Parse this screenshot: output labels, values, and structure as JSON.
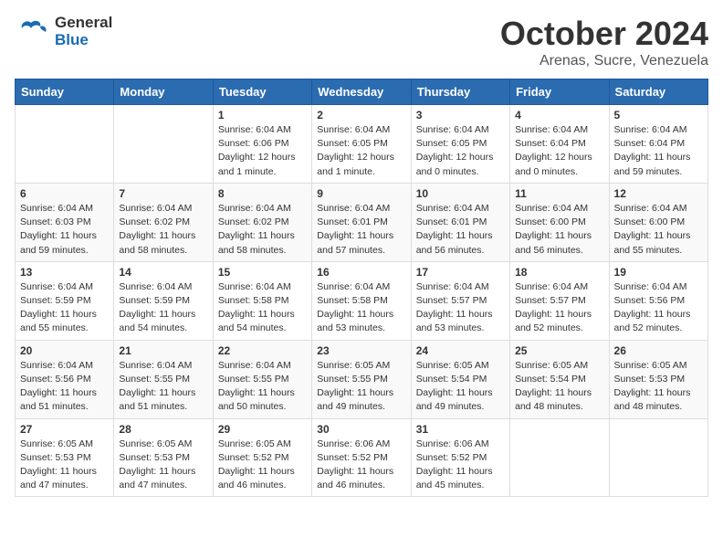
{
  "header": {
    "logo_general": "General",
    "logo_blue": "Blue",
    "month": "October 2024",
    "location": "Arenas, Sucre, Venezuela"
  },
  "weekdays": [
    "Sunday",
    "Monday",
    "Tuesday",
    "Wednesday",
    "Thursday",
    "Friday",
    "Saturday"
  ],
  "weeks": [
    [
      {
        "day": "",
        "info": ""
      },
      {
        "day": "",
        "info": ""
      },
      {
        "day": "1",
        "info": "Sunrise: 6:04 AM\nSunset: 6:06 PM\nDaylight: 12 hours\nand 1 minute."
      },
      {
        "day": "2",
        "info": "Sunrise: 6:04 AM\nSunset: 6:05 PM\nDaylight: 12 hours\nand 1 minute."
      },
      {
        "day": "3",
        "info": "Sunrise: 6:04 AM\nSunset: 6:05 PM\nDaylight: 12 hours\nand 0 minutes."
      },
      {
        "day": "4",
        "info": "Sunrise: 6:04 AM\nSunset: 6:04 PM\nDaylight: 12 hours\nand 0 minutes."
      },
      {
        "day": "5",
        "info": "Sunrise: 6:04 AM\nSunset: 6:04 PM\nDaylight: 11 hours\nand 59 minutes."
      }
    ],
    [
      {
        "day": "6",
        "info": "Sunrise: 6:04 AM\nSunset: 6:03 PM\nDaylight: 11 hours\nand 59 minutes."
      },
      {
        "day": "7",
        "info": "Sunrise: 6:04 AM\nSunset: 6:02 PM\nDaylight: 11 hours\nand 58 minutes."
      },
      {
        "day": "8",
        "info": "Sunrise: 6:04 AM\nSunset: 6:02 PM\nDaylight: 11 hours\nand 58 minutes."
      },
      {
        "day": "9",
        "info": "Sunrise: 6:04 AM\nSunset: 6:01 PM\nDaylight: 11 hours\nand 57 minutes."
      },
      {
        "day": "10",
        "info": "Sunrise: 6:04 AM\nSunset: 6:01 PM\nDaylight: 11 hours\nand 56 minutes."
      },
      {
        "day": "11",
        "info": "Sunrise: 6:04 AM\nSunset: 6:00 PM\nDaylight: 11 hours\nand 56 minutes."
      },
      {
        "day": "12",
        "info": "Sunrise: 6:04 AM\nSunset: 6:00 PM\nDaylight: 11 hours\nand 55 minutes."
      }
    ],
    [
      {
        "day": "13",
        "info": "Sunrise: 6:04 AM\nSunset: 5:59 PM\nDaylight: 11 hours\nand 55 minutes."
      },
      {
        "day": "14",
        "info": "Sunrise: 6:04 AM\nSunset: 5:59 PM\nDaylight: 11 hours\nand 54 minutes."
      },
      {
        "day": "15",
        "info": "Sunrise: 6:04 AM\nSunset: 5:58 PM\nDaylight: 11 hours\nand 54 minutes."
      },
      {
        "day": "16",
        "info": "Sunrise: 6:04 AM\nSunset: 5:58 PM\nDaylight: 11 hours\nand 53 minutes."
      },
      {
        "day": "17",
        "info": "Sunrise: 6:04 AM\nSunset: 5:57 PM\nDaylight: 11 hours\nand 53 minutes."
      },
      {
        "day": "18",
        "info": "Sunrise: 6:04 AM\nSunset: 5:57 PM\nDaylight: 11 hours\nand 52 minutes."
      },
      {
        "day": "19",
        "info": "Sunrise: 6:04 AM\nSunset: 5:56 PM\nDaylight: 11 hours\nand 52 minutes."
      }
    ],
    [
      {
        "day": "20",
        "info": "Sunrise: 6:04 AM\nSunset: 5:56 PM\nDaylight: 11 hours\nand 51 minutes."
      },
      {
        "day": "21",
        "info": "Sunrise: 6:04 AM\nSunset: 5:55 PM\nDaylight: 11 hours\nand 51 minutes."
      },
      {
        "day": "22",
        "info": "Sunrise: 6:04 AM\nSunset: 5:55 PM\nDaylight: 11 hours\nand 50 minutes."
      },
      {
        "day": "23",
        "info": "Sunrise: 6:05 AM\nSunset: 5:55 PM\nDaylight: 11 hours\nand 49 minutes."
      },
      {
        "day": "24",
        "info": "Sunrise: 6:05 AM\nSunset: 5:54 PM\nDaylight: 11 hours\nand 49 minutes."
      },
      {
        "day": "25",
        "info": "Sunrise: 6:05 AM\nSunset: 5:54 PM\nDaylight: 11 hours\nand 48 minutes."
      },
      {
        "day": "26",
        "info": "Sunrise: 6:05 AM\nSunset: 5:53 PM\nDaylight: 11 hours\nand 48 minutes."
      }
    ],
    [
      {
        "day": "27",
        "info": "Sunrise: 6:05 AM\nSunset: 5:53 PM\nDaylight: 11 hours\nand 47 minutes."
      },
      {
        "day": "28",
        "info": "Sunrise: 6:05 AM\nSunset: 5:53 PM\nDaylight: 11 hours\nand 47 minutes."
      },
      {
        "day": "29",
        "info": "Sunrise: 6:05 AM\nSunset: 5:52 PM\nDaylight: 11 hours\nand 46 minutes."
      },
      {
        "day": "30",
        "info": "Sunrise: 6:06 AM\nSunset: 5:52 PM\nDaylight: 11 hours\nand 46 minutes."
      },
      {
        "day": "31",
        "info": "Sunrise: 6:06 AM\nSunset: 5:52 PM\nDaylight: 11 hours\nand 45 minutes."
      },
      {
        "day": "",
        "info": ""
      },
      {
        "day": "",
        "info": ""
      }
    ]
  ]
}
